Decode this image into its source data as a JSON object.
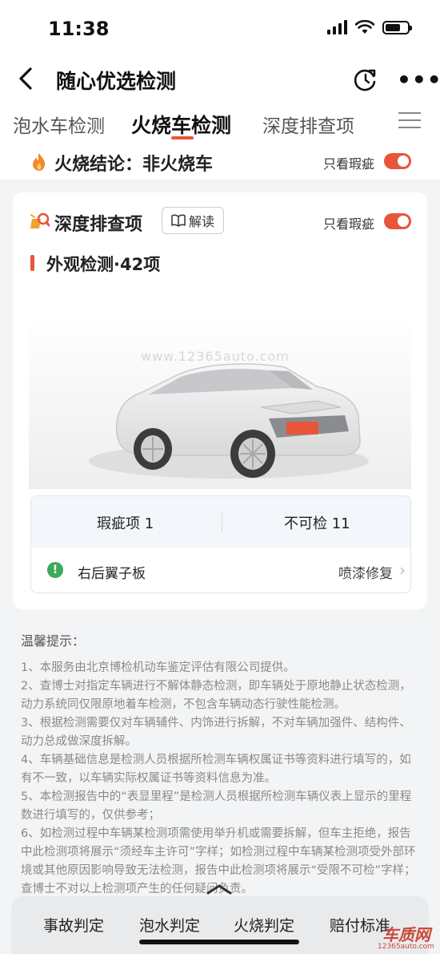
{
  "status_bar": {
    "time": "11:38"
  },
  "nav": {
    "title": "随心优选检测"
  },
  "tabs": [
    {
      "label": "泡水车检测"
    },
    {
      "label": "火烧车检测",
      "active": true
    },
    {
      "label": "深度排查项"
    }
  ],
  "conclusion": {
    "text": "火烧结论：非火烧车",
    "toggle_label": "只看瑕疵",
    "toggle_on": true
  },
  "card": {
    "title": "深度排查项",
    "read_button": "解读",
    "toggle_label": "只看瑕疵",
    "toggle_on": true,
    "section_title": "外观检测·42项",
    "watermark": "www.12365auto.com",
    "stats": {
      "defects": "瑕疵项 1",
      "uncheckable": "不可检 11"
    },
    "issue": {
      "name": "右后翼子板",
      "status": "喷漆修复"
    }
  },
  "tips": {
    "title": "温馨提示：",
    "items": [
      "1、本服务由北京博检机动车鉴定评估有限公司提供。",
      "2、查博士对指定车辆进行不解体静态检测，即车辆处于原地静止状态检测，动力系统同仅限原地着车检测，不包含车辆动态行驶性能检测。",
      "3、根据检测需要仅对车辆辅件、内饰进行拆解，不对车辆加强件、结构件、动力总成做深度拆解。",
      "4、车辆基础信息是检测人员根据所检测车辆权属证书等资料进行填写的，如有不一致，以车辆实际权属证书等资料信息为准。",
      "5、本检测报告中的“表显里程”是检测人员根据所检测车辆仪表上显示的里程数进行填写的，仅供参考；",
      "6、如检测过程中车辆某检测项需使用举升机或需要拆解，但车主拒绝，报告中此检测项将展示“须经车主许可”字样；如检测过程中车辆某检测项受外部环境或其他原因影响导致无法检测，报告中此检测项将展示“受限不可检”字样；查博士不对以上检测项产生的任何疑问负责。"
    ]
  },
  "bottom_nav": [
    {
      "label": "事故判定"
    },
    {
      "label": "泡水判定"
    },
    {
      "label": "火烧判定"
    },
    {
      "label": "赔付标准"
    }
  ],
  "site_logo": {
    "name": "车质网",
    "url": "12365auto.com"
  },
  "colors": {
    "accent": "#e8553a",
    "ok_green": "#3aaa5c"
  }
}
